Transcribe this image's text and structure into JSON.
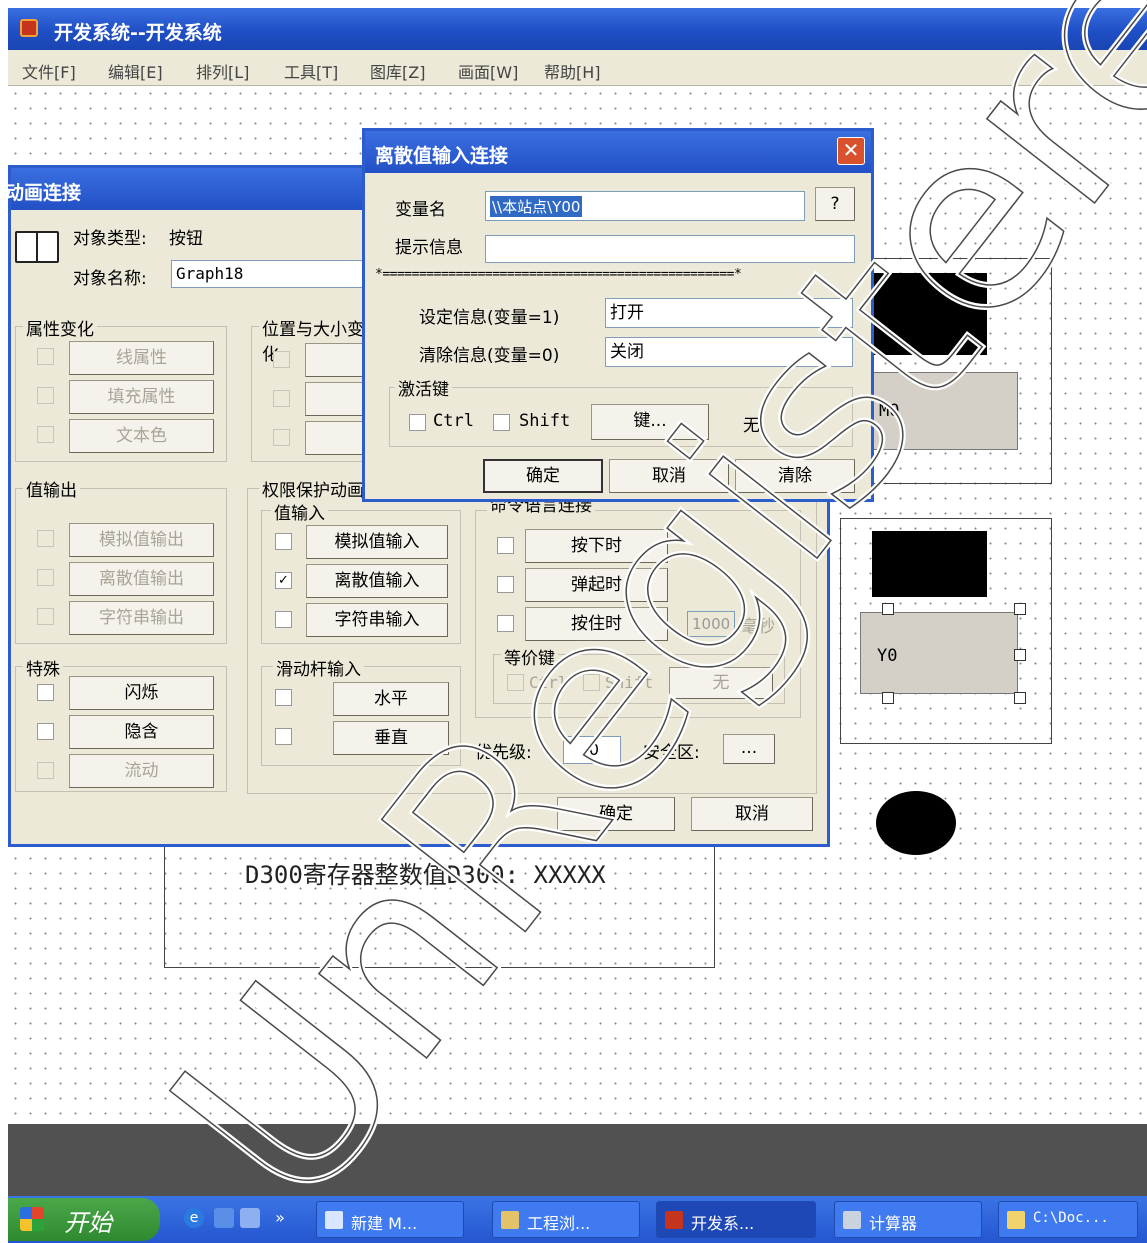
{
  "app": {
    "title": "开发系统--开发系统",
    "menu": [
      "文件[F]",
      "编辑[E]",
      "排列[L]",
      "工具[T]",
      "图库[Z]",
      "画面[W]",
      "帮助[H]"
    ]
  },
  "canvas": {
    "btn_m0": "M0",
    "btn_y0": "Y0",
    "register_label": "D300寄存器整数值D300: XXXXX"
  },
  "anim_dialog": {
    "title": "动画连接",
    "object_type_label": "对象类型:",
    "object_type_value": "按钮",
    "object_name_label": "对象名称:",
    "object_name_value": "Graph18",
    "attr_group": "属性变化",
    "attr_buttons": [
      "线属性",
      "填充属性",
      "文本色"
    ],
    "pos_group": "位置与大小变化",
    "value_output_group": "值输出",
    "value_output_buttons": [
      "模拟值输出",
      "离散值输出",
      "字符串输出"
    ],
    "special_group": "特殊",
    "special_buttons": [
      "闪烁",
      "隐含",
      "流动"
    ],
    "perm_group": "权限保护动画连接",
    "value_input_group": "值输入",
    "value_input_buttons": [
      "模拟值输入",
      "离散值输入",
      "字符串输入"
    ],
    "slider_group": "滑动杆输入",
    "slider_buttons": [
      "水平",
      "垂直"
    ],
    "cmd_group": "命令语言连接",
    "cmd_buttons": [
      "按下时",
      "弹起时",
      "按住时"
    ],
    "hold_ms": "1000",
    "ms_unit": "毫秒",
    "equiv_group": "等价键",
    "equiv_ctrl": "Ctrl",
    "equiv_shift": "Shift",
    "equiv_key": "无",
    "priority_label": "优先级:",
    "priority_value": "0",
    "safety_label": "安全区:",
    "safety_btn": "...",
    "ok": "确定",
    "cancel": "取消"
  },
  "discrete_dialog": {
    "title": "离散值输入连接",
    "var_label": "变量名",
    "var_value": "\\\\本站点\\Y00",
    "help_btn": "?",
    "hint_label": "提示信息",
    "hint_value": "",
    "separator": "*================================================*",
    "set_label": "设定信息(变量=1)",
    "set_value": "打开",
    "clear_label": "清除信息(变量=0)",
    "clear_value": "关闭",
    "hotkey_group": "激活键",
    "ctrl": "Ctrl",
    "shift": "Shift",
    "key_btn": "键...",
    "key_value": "无",
    "ok": "确定",
    "cancel": "取消",
    "clear": "清除"
  },
  "taskbar": {
    "start": "开始",
    "tasks": [
      "新建 M...",
      "工程浏...",
      "开发系...",
      "计算器",
      "C:\\Doc..."
    ]
  },
  "watermark": "UnRegistered"
}
